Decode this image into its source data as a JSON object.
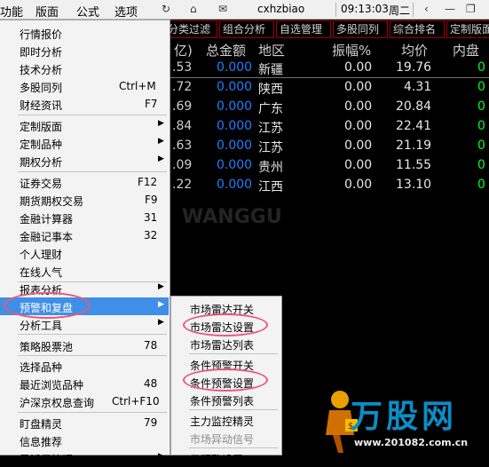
{
  "menubar": {
    "items": [
      "功能",
      "版面",
      "公式",
      "选项"
    ],
    "username": "cxhzbiao",
    "time": "09:13:03",
    "weekday": "周二"
  },
  "tabs": [
    "分类过滤",
    "组合分析",
    "自选管理",
    "多股同列",
    "综合排名",
    "定制版面"
  ],
  "table": {
    "headers": [
      "亿)",
      "总金额",
      "地区",
      "振幅%",
      "均价",
      "内盘"
    ],
    "rows": [
      {
        "a": ".53",
        "amount": "0.000",
        "region": "新疆",
        "amp": "0.00",
        "avg": "19.76",
        "inner": "0"
      },
      {
        "a": ".72",
        "amount": "0.000",
        "region": "陕西",
        "amp": "0.00",
        "avg": "4.31",
        "inner": "0"
      },
      {
        "a": ".69",
        "amount": "0.000",
        "region": "广东",
        "amp": "0.00",
        "avg": "20.84",
        "inner": "0"
      },
      {
        "a": ".84",
        "amount": "0.000",
        "region": "江苏",
        "amp": "0.00",
        "avg": "22.41",
        "inner": "0"
      },
      {
        "a": ".63",
        "amount": "0.000",
        "region": "江苏",
        "amp": "0.00",
        "avg": "21.19",
        "inner": "0"
      },
      {
        "a": ".09",
        "amount": "0.000",
        "region": "贵州",
        "amp": "0.00",
        "avg": "11.55",
        "inner": "0"
      },
      {
        "a": ".22",
        "amount": "0.000",
        "region": "江西",
        "amp": "0.00",
        "avg": "13.10",
        "inner": "0"
      }
    ]
  },
  "menu": {
    "items": [
      {
        "label": "行情报价",
        "shortcut": "",
        "arrow": false
      },
      {
        "label": "即时分析",
        "shortcut": "",
        "arrow": false
      },
      {
        "label": "技术分析",
        "shortcut": "",
        "arrow": false
      },
      {
        "label": "多股同列",
        "shortcut": "Ctrl+M",
        "arrow": false
      },
      {
        "label": "财经资讯",
        "shortcut": "F7",
        "arrow": false
      },
      {
        "label": "定制版面",
        "shortcut": "",
        "arrow": true
      },
      {
        "label": "定制品种",
        "shortcut": "",
        "arrow": true
      },
      {
        "label": "期权分析",
        "shortcut": "",
        "arrow": true
      },
      {
        "label": "证券交易",
        "shortcut": "F12",
        "arrow": false
      },
      {
        "label": "期货期权交易",
        "shortcut": "F9",
        "arrow": false
      },
      {
        "label": "金融计算器",
        "shortcut": "31",
        "arrow": false
      },
      {
        "label": "金融记事本",
        "shortcut": "32",
        "arrow": false
      },
      {
        "label": "个人理财",
        "shortcut": "",
        "arrow": false
      },
      {
        "label": "在线人气",
        "shortcut": "",
        "arrow": false
      },
      {
        "label": "报表分析",
        "shortcut": "",
        "arrow": true
      },
      {
        "label": "预警和复盘",
        "shortcut": "",
        "arrow": true
      },
      {
        "label": "分析工具",
        "shortcut": "",
        "arrow": true
      },
      {
        "label": "策略股票池",
        "shortcut": "78",
        "arrow": false
      },
      {
        "label": "选择品种",
        "shortcut": "",
        "arrow": false
      },
      {
        "label": "最近浏览品种",
        "shortcut": "48",
        "arrow": false
      },
      {
        "label": "沪深京权息查询",
        "shortcut": "Ctrl+F10",
        "arrow": false
      },
      {
        "label": "盯盘精灵",
        "shortcut": "79",
        "arrow": false
      },
      {
        "label": "信息推荐",
        "shortcut": "",
        "arrow": false
      },
      {
        "label": "灵活屏管理",
        "shortcut": "",
        "arrow": true
      }
    ]
  },
  "submenu": {
    "items": [
      {
        "label": "市场雷达开关",
        "disabled": false
      },
      {
        "label": "市场雷达设置",
        "disabled": false
      },
      {
        "label": "市场雷达列表",
        "disabled": false
      },
      {
        "label": "条件预警开关",
        "disabled": false
      },
      {
        "label": "条件预警设置",
        "disabled": false
      },
      {
        "label": "条件预警列表",
        "disabled": false
      },
      {
        "label": "主力监控精灵",
        "disabled": false
      },
      {
        "label": "市场异动信号",
        "disabled": true
      },
      {
        "label": "云预警设置",
        "disabled": false
      }
    ]
  },
  "watermark": {
    "brand": "万股网",
    "url": "www.201082.com.cn"
  },
  "colors": {
    "highlight": "#3f8fe8",
    "blue_value": "#1f7fff",
    "green_value": "#00ff20",
    "annotation": "#e85a7a"
  }
}
